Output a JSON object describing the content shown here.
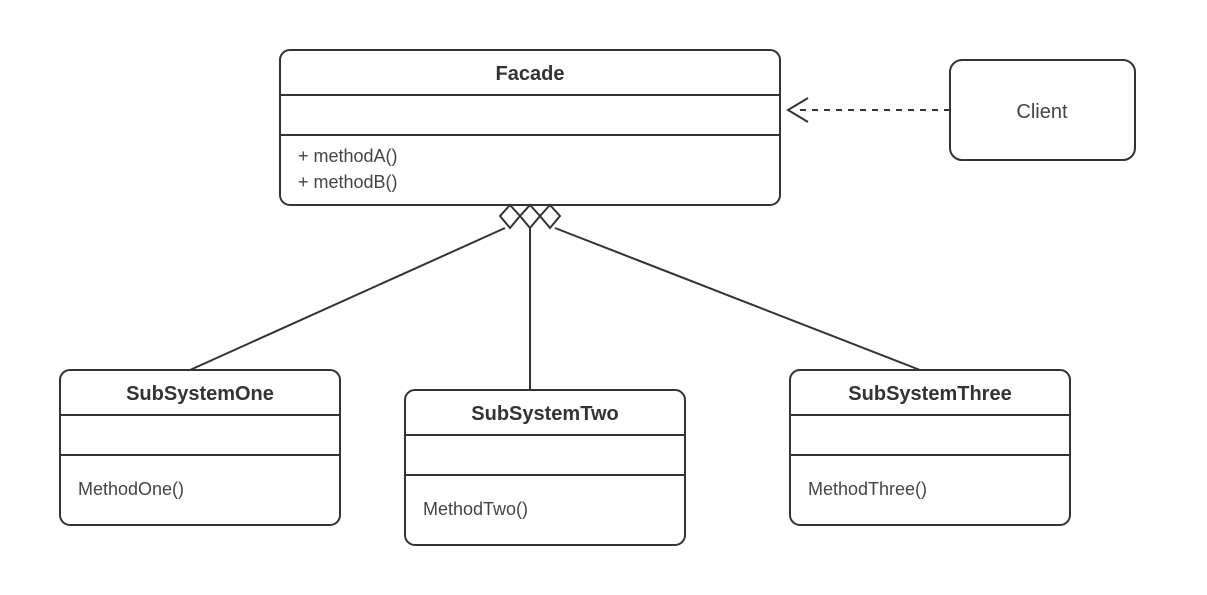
{
  "diagram": {
    "pattern": "Facade",
    "facade": {
      "name": "Facade",
      "methods": [
        "+ methodA()",
        "+ methodB()"
      ]
    },
    "client": {
      "name": "Client"
    },
    "subsystems": [
      {
        "name": "SubSystemOne",
        "method": "MethodOne()"
      },
      {
        "name": "SubSystemTwo",
        "method": "MethodTwo()"
      },
      {
        "name": "SubSystemThree",
        "method": "MethodThree()"
      }
    ],
    "relationships": {
      "client_to_facade": "dependency",
      "facade_to_subsystems": "aggregation"
    }
  }
}
